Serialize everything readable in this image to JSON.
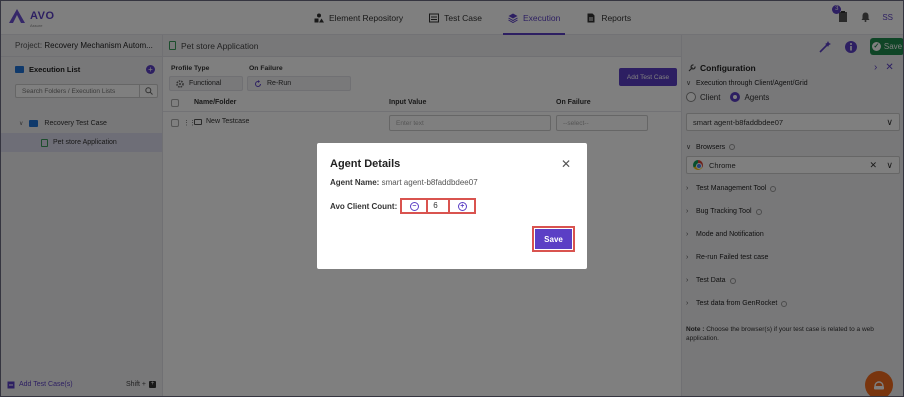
{
  "app": {
    "logo_text": "AVO",
    "logo_sub": "Assure",
    "notification_count": "3",
    "user_initials": "SS"
  },
  "nav": {
    "tabs": [
      {
        "label": "Element Repository",
        "icon": "element-icon"
      },
      {
        "label": "Test Case",
        "icon": "testcase-icon"
      },
      {
        "label": "Execution",
        "icon": "layers-icon",
        "active": true
      },
      {
        "label": "Reports",
        "icon": "report-icon"
      }
    ]
  },
  "project": {
    "label": "Project:",
    "name": "Recovery Mechanism Autom..."
  },
  "left": {
    "execution_list": "Execution List",
    "search_placeholder": "Search Folders / Execution Lists",
    "tree": [
      {
        "label": "Recovery Test Case"
      },
      {
        "label": "Pet store Application"
      }
    ],
    "add_test_cases": "Add Test Case(s)",
    "shortcut": "Shift +"
  },
  "center": {
    "title": "Pet store Application",
    "profile_type_label": "Profile Type",
    "profile_type_value": "Functional",
    "on_failure_label": "On Failure",
    "on_failure_value": "Re-Run",
    "add_test_case": "Add Test Case",
    "columns": [
      "Name/Folder",
      "Input Value",
      "On Failure"
    ],
    "rows": [
      {
        "name": "New Testcase",
        "input_placeholder": "Enter text",
        "on_failure_placeholder": "--select--"
      }
    ]
  },
  "right": {
    "save": "Save",
    "config_title": "Configuration",
    "exec_through": "Execution through Client/Agent/Grid",
    "radio_client": "Client",
    "radio_agents": "Agents",
    "agent_select": "smart agent-b8faddbdee07",
    "browsers": "Browsers",
    "browser_value": "Chrome",
    "sections": [
      "Test Management Tool",
      "Bug Tracking Tool",
      "Mode and Notification",
      "Re-run Failed test case",
      "Test Data",
      "Test data from GenRocket"
    ],
    "note_label": "Note :",
    "note_text": "Choose the browser(s) if your test case is related to a web application."
  },
  "modal": {
    "title": "Agent Details",
    "agent_name_label": "Agent Name:",
    "agent_name_value": "smart agent-b8faddbdee07",
    "client_count_label": "Avo Client Count:",
    "client_count_value": "6",
    "save": "Save"
  },
  "colors": {
    "accent": "#5b3fc5",
    "save_green": "#1f8a4c",
    "highlight_red": "#d9534f",
    "fab_orange": "#f26b1d"
  }
}
